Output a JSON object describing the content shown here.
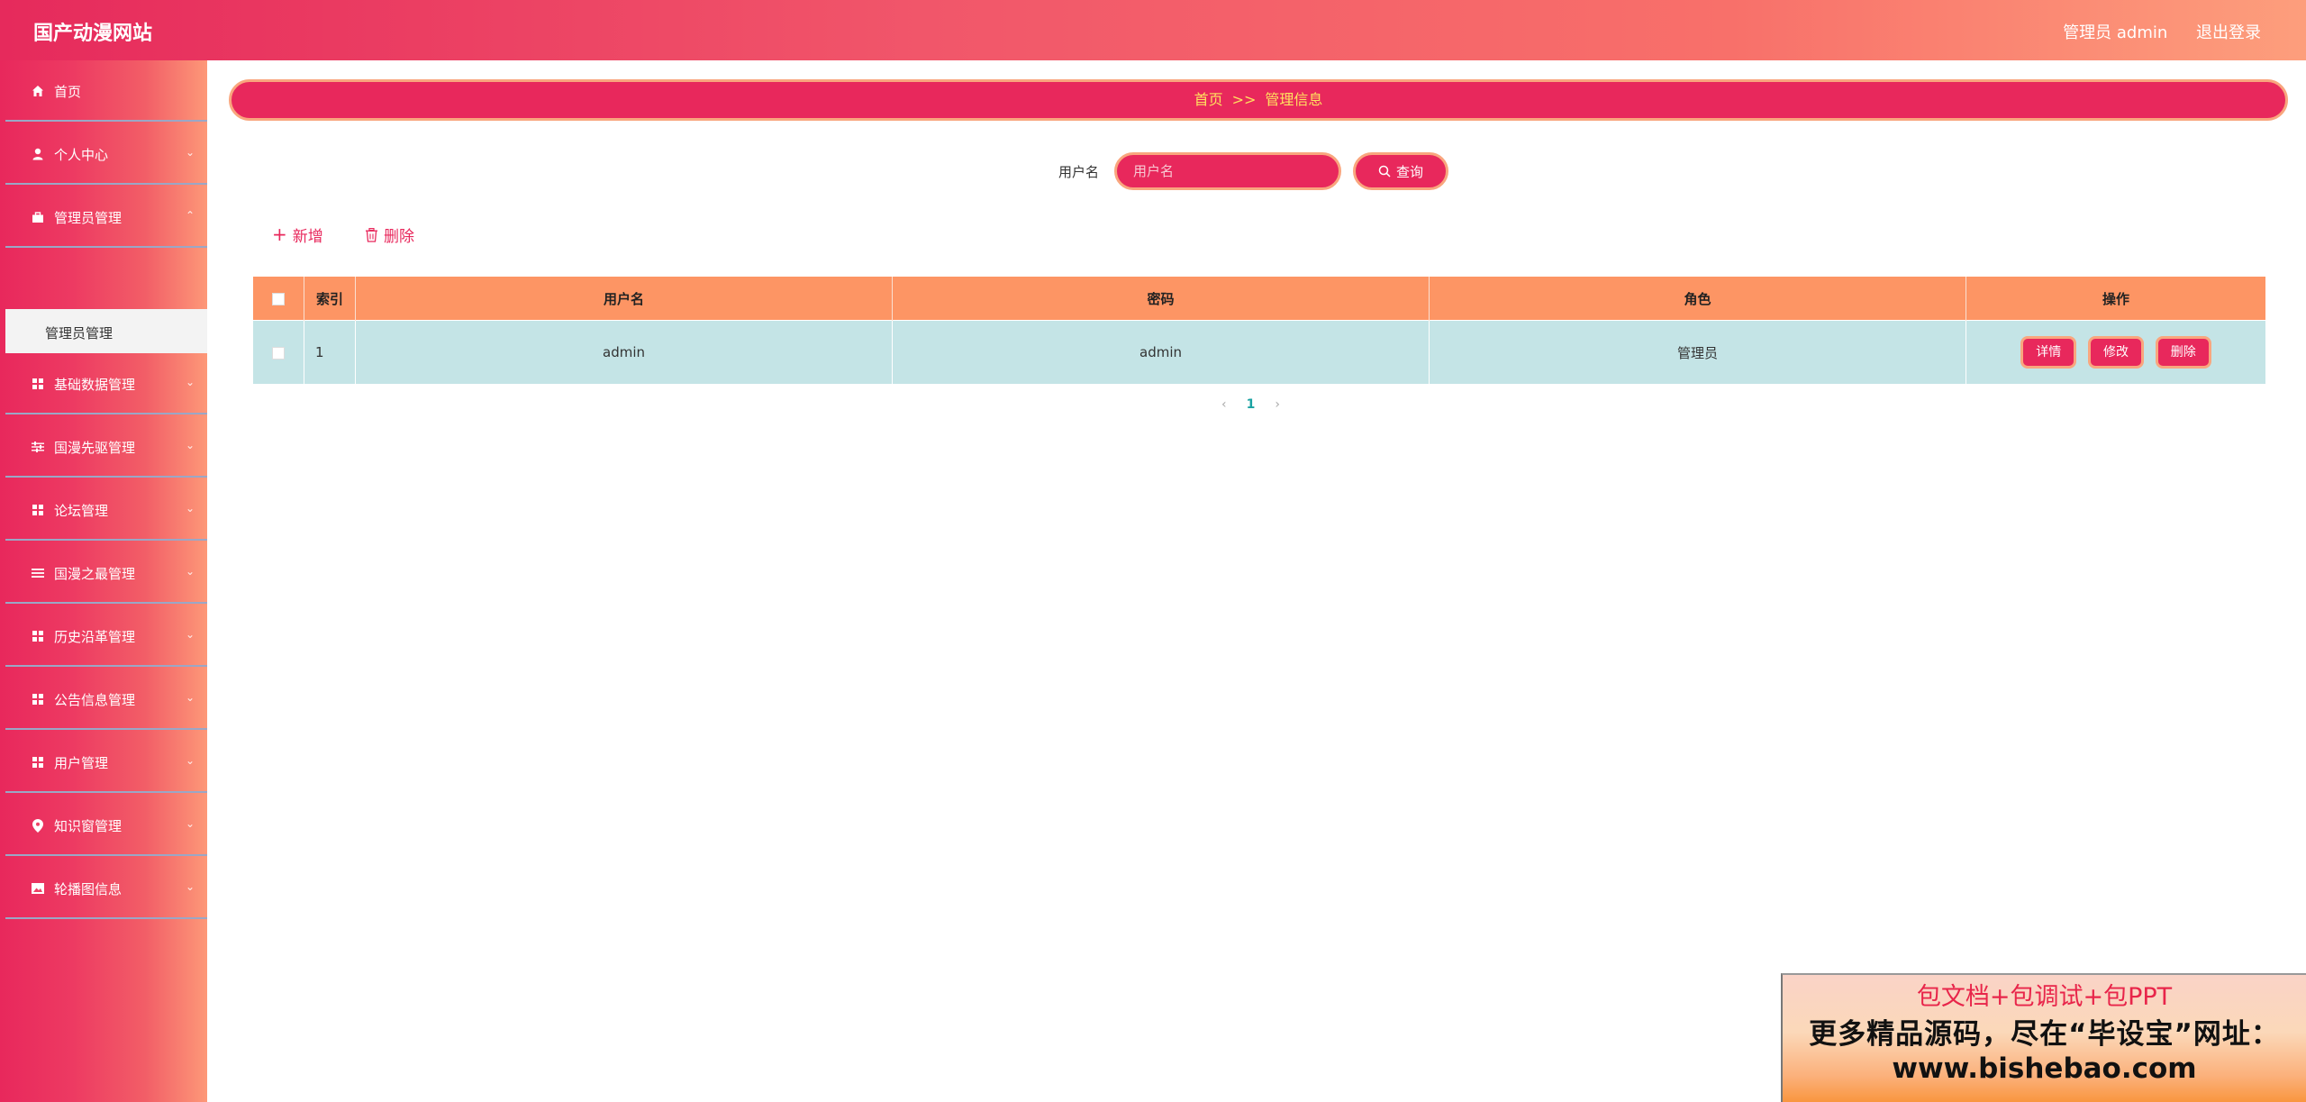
{
  "header": {
    "title": "国产动漫网站",
    "user": "管理员 admin",
    "logout": "退出登录"
  },
  "sidebar": {
    "items": [
      {
        "label": "首页",
        "icon": "home-icon",
        "arrow": false
      },
      {
        "label": "个人中心",
        "icon": "user-icon",
        "arrow": true
      },
      {
        "label": "管理员管理",
        "icon": "briefcase-icon",
        "arrow": true
      },
      {
        "label": "基础数据管理",
        "icon": "grid-icon",
        "arrow": true
      },
      {
        "label": "国漫先驱管理",
        "icon": "sliders-icon",
        "arrow": true
      },
      {
        "label": "论坛管理",
        "icon": "grid-icon",
        "arrow": true
      },
      {
        "label": "国漫之最管理",
        "icon": "list-icon",
        "arrow": true
      },
      {
        "label": "历史沿革管理",
        "icon": "grid-icon",
        "arrow": true
      },
      {
        "label": "公告信息管理",
        "icon": "grid-icon",
        "arrow": true
      },
      {
        "label": "用户管理",
        "icon": "grid-icon",
        "arrow": true
      },
      {
        "label": "知识窗管理",
        "icon": "location-icon",
        "arrow": true
      },
      {
        "label": "轮播图信息",
        "icon": "picture-icon",
        "arrow": true
      }
    ],
    "sub_item": "管理员管理"
  },
  "breadcrumb": {
    "home": "首页",
    "separator": ">>",
    "current": "管理信息"
  },
  "search": {
    "label": "用户名",
    "placeholder": "用户名",
    "value": "",
    "button": "查询"
  },
  "actions": {
    "add": "新增",
    "delete": "删除"
  },
  "table": {
    "headers": [
      "索引",
      "用户名",
      "密码",
      "角色",
      "操作"
    ],
    "rows": [
      {
        "index": "1",
        "username": "admin",
        "password": "admin",
        "role": "管理员"
      }
    ],
    "row_actions": [
      "详情",
      "修改",
      "删除"
    ]
  },
  "pagination": {
    "current": "1"
  },
  "ad": {
    "line1": "包文档+包调试+包PPT",
    "line2": "更多精品源码，尽在“毕设宝”网址：",
    "line3": "www.bishebao.com"
  },
  "colors": {
    "primary": "#e8285c",
    "accent_border": "#f9a67e",
    "table_header": "#fd9564",
    "table_row": "#c4e4e6",
    "breadcrumb_text": "#ffe25f"
  }
}
